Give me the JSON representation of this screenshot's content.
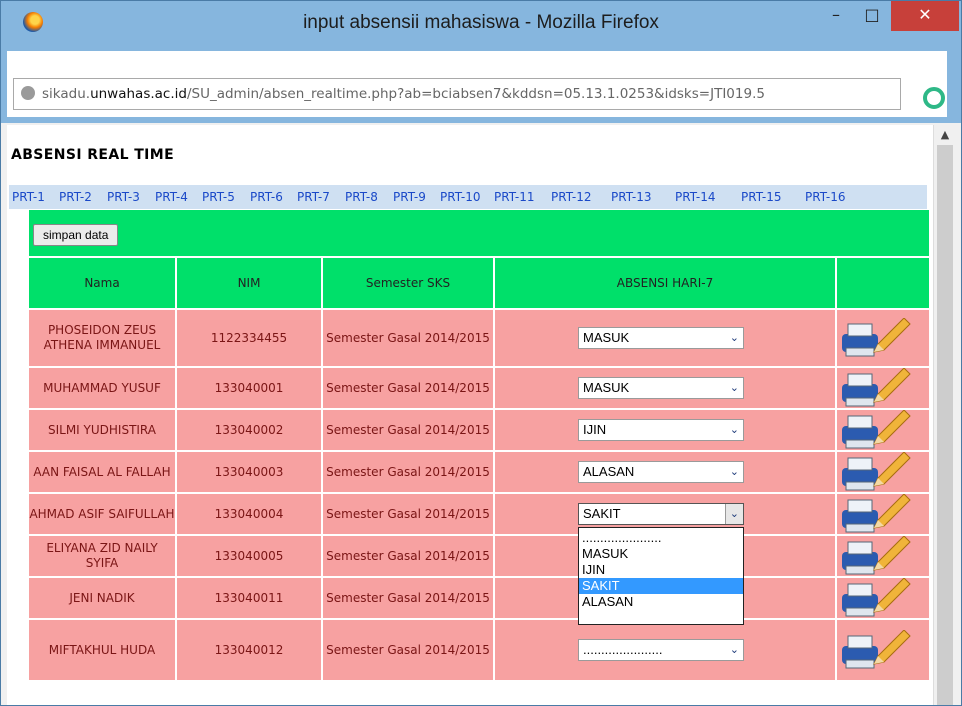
{
  "window": {
    "title": "input absensii mahasiswa - Mozilla Firefox",
    "min_glyph": "–",
    "max_glyph": "□",
    "close_glyph": "✕"
  },
  "address": {
    "prefix": "sikadu.",
    "domain": "unwahas.ac.id",
    "path": "/SU_admin/absen_realtime.php?ab=bciabsen7&kddsn=05.13.1.0253&idsks=JTI019.5"
  },
  "page": {
    "heading": "ABSENSI REAL TIME",
    "meetings": [
      "PRT-1",
      "PRT-2",
      "PRT-3",
      "PRT-4",
      "PRT-5",
      "PRT-6",
      "PRT-7",
      "PRT-8",
      "PRT-9",
      "PRT-10",
      "PRT-11",
      "PRT-12",
      "PRT-13",
      "PRT-14",
      "PRT-15",
      "PRT-16"
    ],
    "save_label": "simpan data"
  },
  "table": {
    "headers": {
      "nama": "Nama",
      "nim": "NIM",
      "semester": "Semester SKS",
      "absensi": "ABSENSI HARI-7",
      "aksi": ""
    },
    "rows": [
      {
        "nama": "PHOSEIDON ZEUS ATHENA IMMANUEL",
        "nim": "1122334455",
        "semester": "Semester Gasal 2014/2015",
        "absensi": "MASUK"
      },
      {
        "nama": "MUHAMMAD YUSUF",
        "nim": "133040001",
        "semester": "Semester Gasal 2014/2015",
        "absensi": "MASUK"
      },
      {
        "nama": "SILMI YUDHISTIRA",
        "nim": "133040002",
        "semester": "Semester Gasal 2014/2015",
        "absensi": "IJIN"
      },
      {
        "nama": "AAN FAISAL AL FALLAH",
        "nim": "133040003",
        "semester": "Semester Gasal 2014/2015",
        "absensi": "ALASAN"
      },
      {
        "nama": "AHMAD ASIF SAIFULLAH",
        "nim": "133040004",
        "semester": "Semester Gasal 2014/2015",
        "absensi": "SAKIT"
      },
      {
        "nama": "ELIYANA ZID NAILY SYIFA",
        "nim": "133040005",
        "semester": "Semester Gasal 2014/2015",
        "absensi": ""
      },
      {
        "nama": "JENI NADIK",
        "nim": "133040011",
        "semester": "Semester Gasal 2014/2015",
        "absensi": ""
      },
      {
        "nama": "MIFTAKHUL HUDA",
        "nim": "133040012",
        "semester": "Semester Gasal 2014/2015",
        "absensi": "......................"
      }
    ]
  },
  "dropdown": {
    "options": [
      "......................",
      "MASUK",
      "IJIN",
      "SAKIT",
      "ALASAN"
    ],
    "selected": "SAKIT"
  },
  "colors": {
    "accent_green": "#00e06a",
    "row_pink": "#f7a1a1",
    "link_blue": "#1a49c8",
    "selected_blue": "#3399ff"
  }
}
